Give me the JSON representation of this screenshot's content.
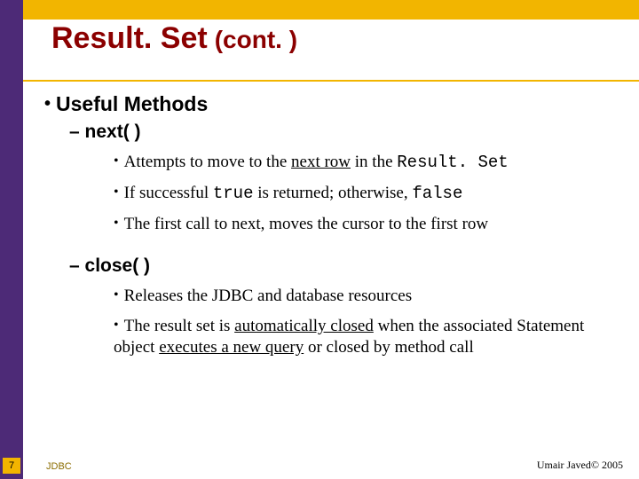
{
  "title": {
    "main": "Result. Set",
    "sub": "(cont. )"
  },
  "h1": "Useful Methods",
  "m1": {
    "name": "– next( )",
    "b1_pre": "Attempts to move to the ",
    "b1_ul": "next row",
    "b1_mid": " in the ",
    "b1_code": "Result. Set",
    "b2_pre": "If successful ",
    "b2_code1": "true",
    "b2_mid": " is returned; otherwise, ",
    "b2_code2": "false",
    "b3": "The first call to next, moves the cursor to the first row"
  },
  "m2": {
    "name": "– close( )",
    "b1": "Releases the JDBC and database resources",
    "b2_a": "The result set is ",
    "b2_ul1": "automatically closed",
    "b2_b": " when the associated Statement object ",
    "b2_ul2": "executes a new query",
    "b2_c": " or closed by method call"
  },
  "footer": {
    "num": "7",
    "left": "JDBC",
    "right": "Umair Javed© 2005"
  }
}
